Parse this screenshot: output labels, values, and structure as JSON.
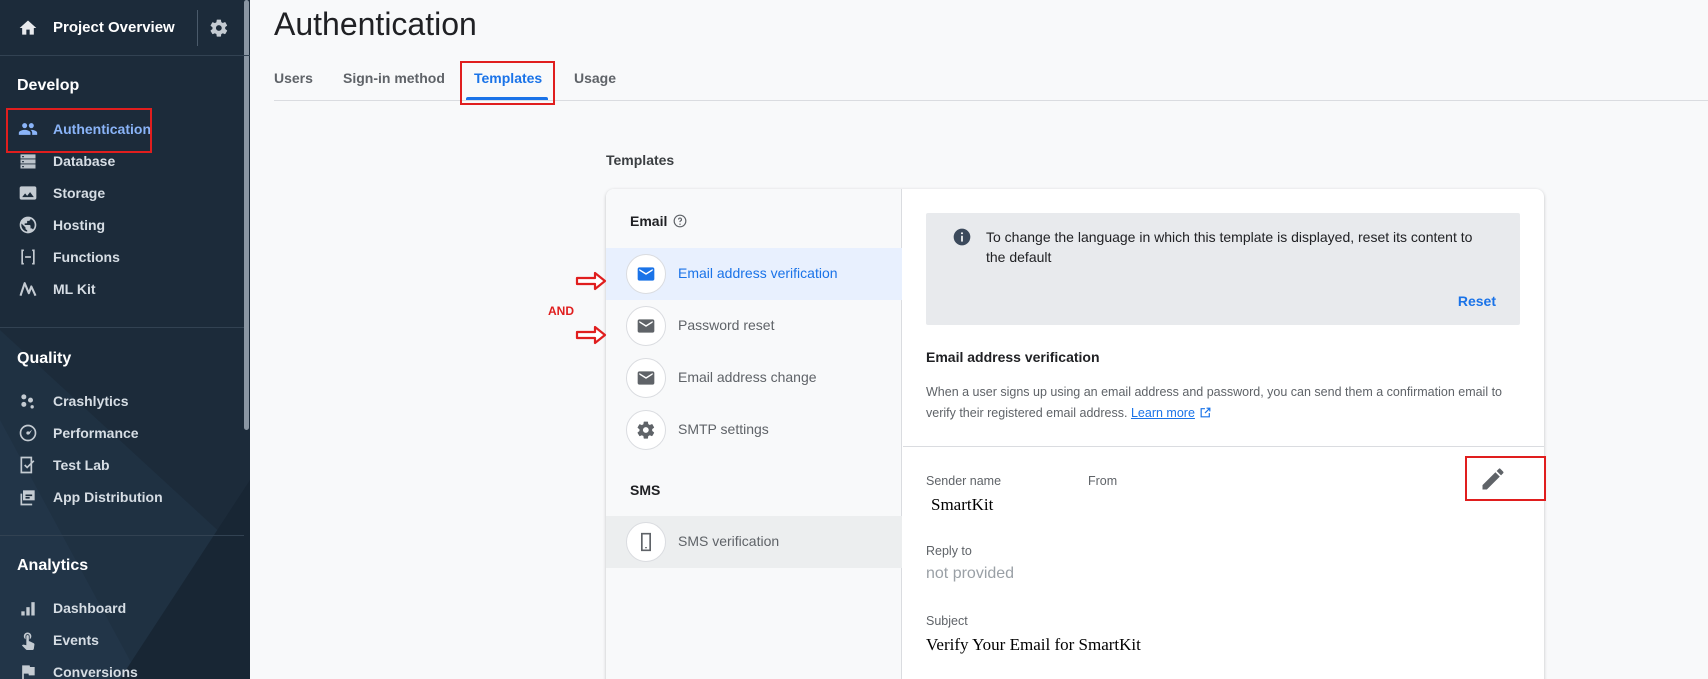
{
  "sidebar": {
    "project_title": "Project Overview",
    "sections": {
      "develop": "Develop",
      "quality": "Quality",
      "analytics": "Analytics"
    },
    "develop_items": [
      {
        "label": "Authentication",
        "icon": "people-icon"
      },
      {
        "label": "Database",
        "icon": "database-icon"
      },
      {
        "label": "Storage",
        "icon": "image-icon"
      },
      {
        "label": "Hosting",
        "icon": "globe-icon"
      },
      {
        "label": "Functions",
        "icon": "functions-icon"
      },
      {
        "label": "ML Kit",
        "icon": "ml-kit-icon"
      }
    ],
    "quality_items": [
      {
        "label": "Crashlytics",
        "icon": "crashlytics-icon"
      },
      {
        "label": "Performance",
        "icon": "speedometer-icon"
      },
      {
        "label": "Test Lab",
        "icon": "checklist-icon"
      },
      {
        "label": "App Distribution",
        "icon": "app-distribution-icon"
      }
    ],
    "analytics_items": [
      {
        "label": "Dashboard",
        "icon": "bar-chart-icon"
      },
      {
        "label": "Events",
        "icon": "touch-icon"
      },
      {
        "label": "Conversions",
        "icon": "flag-icon"
      }
    ]
  },
  "main": {
    "title": "Authentication",
    "tabs": [
      "Users",
      "Sign-in method",
      "Templates",
      "Usage"
    ],
    "active_tab": "Templates",
    "section_label": "Templates"
  },
  "templates": {
    "email_group": "Email",
    "sms_group": "SMS",
    "email_items": [
      {
        "label": "Email address verification",
        "icon": "mail-icon"
      },
      {
        "label": "Password reset",
        "icon": "mail-icon"
      },
      {
        "label": "Email address change",
        "icon": "mail-icon"
      },
      {
        "label": "SMTP settings",
        "icon": "gear-icon"
      }
    ],
    "sms_items": [
      {
        "label": "SMS verification",
        "icon": "phone-icon"
      }
    ],
    "selected": "Email address verification"
  },
  "detail": {
    "info_text": "To change the language in which this template is displayed, reset its content to the default",
    "reset_label": "Reset",
    "heading": "Email address verification",
    "description": "When a user signs up using an email address and password, you can send them a confirmation email to verify their registered email address.",
    "learn_more": "Learn more",
    "sender_name_label": "Sender name",
    "sender_name_value": "SmartKit",
    "from_label": "From",
    "reply_to_label": "Reply to",
    "reply_to_value": "not provided",
    "subject_label": "Subject",
    "subject_value": "Verify Your Email for SmartKit"
  },
  "annotations": {
    "and_label": "AND",
    "highlight_color": "#e01e1e"
  },
  "colors": {
    "sidebar_bg": "#1c2b3a",
    "accent": "#1a73e8",
    "sidebar_active": "#8ab4f8"
  }
}
